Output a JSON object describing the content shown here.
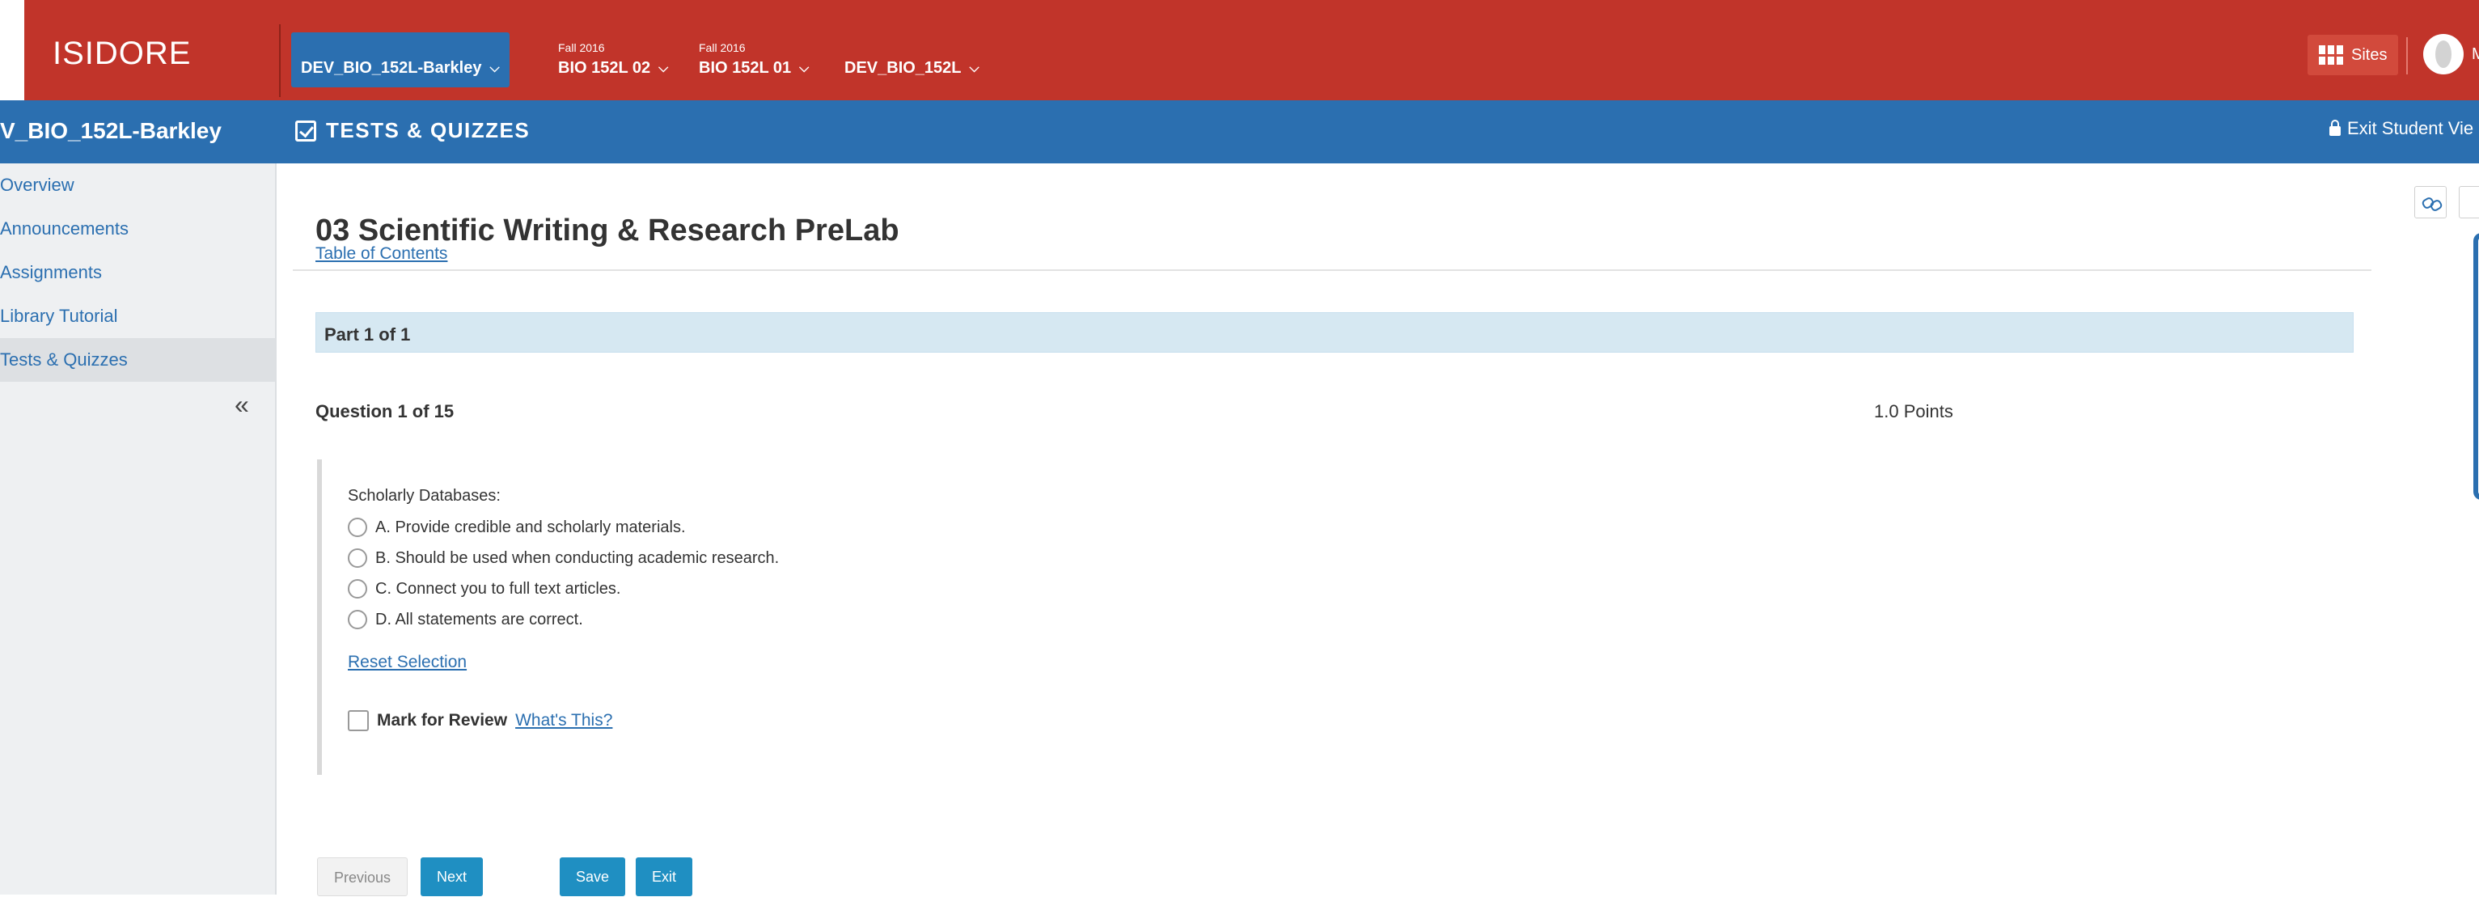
{
  "header": {
    "brand": "ISIDORE",
    "site_tabs": [
      {
        "term": "",
        "name": "DEV_BIO_152L-Barkley",
        "active": true
      },
      {
        "term": "Fall 2016",
        "name": "BIO 152L 02",
        "active": false
      },
      {
        "term": "Fall 2016",
        "name": "BIO 152L 01",
        "active": false
      },
      {
        "term": "",
        "name": "DEV_BIO_152L",
        "active": false
      }
    ],
    "sites_label": "Sites",
    "user_name": "Marg"
  },
  "subheader": {
    "site_title": "V_BIO_152L-Barkley",
    "tool_title": "TESTS & QUIZZES",
    "exit_view_label": "Exit Student Vie"
  },
  "sidebar": {
    "items": [
      {
        "label": "Overview"
      },
      {
        "label": "Announcements"
      },
      {
        "label": "Assignments"
      },
      {
        "label": "Library Tutorial"
      },
      {
        "label": "Tests & Quizzes"
      }
    ],
    "active_index": 4,
    "collapse_glyph": "«"
  },
  "main": {
    "heading": "03 Scientific Writing & Research PreLab",
    "toc_link": "Table of Contents",
    "part_label": "Part 1 of 1",
    "question_label": "Question 1 of 15",
    "points": "1.0 Points",
    "question_text": "Scholarly Databases:",
    "options": [
      "A. Provide credible and scholarly materials.",
      "B. Should be used when conducting academic research.",
      "C. Connect you to full text articles.",
      "D. All statements are correct."
    ],
    "reset_selection": "Reset Selection",
    "mark_for_review": "Mark for Review",
    "whats_this": " What's This?",
    "buttons": {
      "previous": "Previous",
      "next": "Next",
      "save": "Save",
      "exit": "Exit"
    }
  },
  "colors": {
    "topbar": "#c1342a",
    "subbar": "#2b6fb0",
    "accent_button": "#1f8fc2",
    "part_bar": "#d6e8f2"
  }
}
